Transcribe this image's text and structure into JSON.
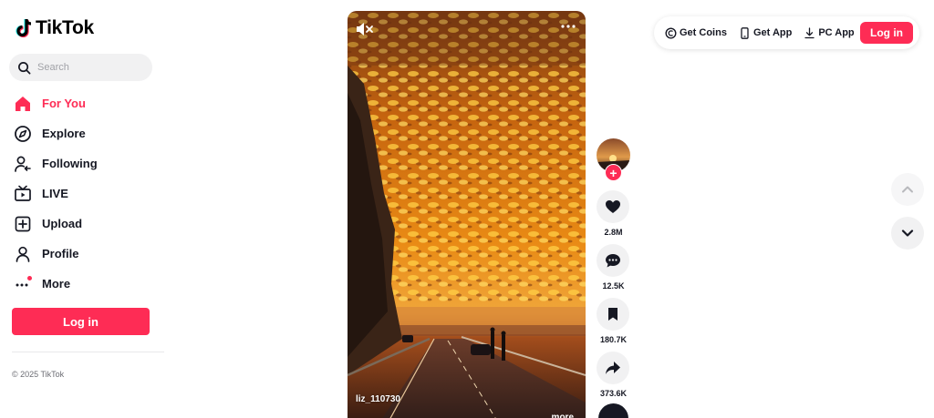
{
  "brand": {
    "name": "TikTok",
    "accent": "#fe2c55"
  },
  "search": {
    "placeholder": "Search"
  },
  "nav": {
    "items": [
      {
        "label": "For You",
        "icon": "home-icon",
        "active": true
      },
      {
        "label": "Explore",
        "icon": "compass-icon"
      },
      {
        "label": "Following",
        "icon": "following-icon"
      },
      {
        "label": "LIVE",
        "icon": "live-tv-icon"
      },
      {
        "label": "Upload",
        "icon": "upload-plus-icon"
      },
      {
        "label": "Profile",
        "icon": "profile-icon"
      },
      {
        "label": "More",
        "icon": "more-dots-icon"
      }
    ]
  },
  "sidebar": {
    "login_label": "Log in",
    "copyright": "© 2025 TikTok"
  },
  "video": {
    "author": "liz_110730",
    "more_label": "more"
  },
  "actions": {
    "follow_symbol": "+",
    "likes": "2.8M",
    "comments": "12.5K",
    "saves": "180.7K",
    "shares": "373.6K"
  },
  "topbar": {
    "get_coins": "Get Coins",
    "get_app": "Get App",
    "pc_app": "PC App",
    "login_label": "Log in"
  }
}
